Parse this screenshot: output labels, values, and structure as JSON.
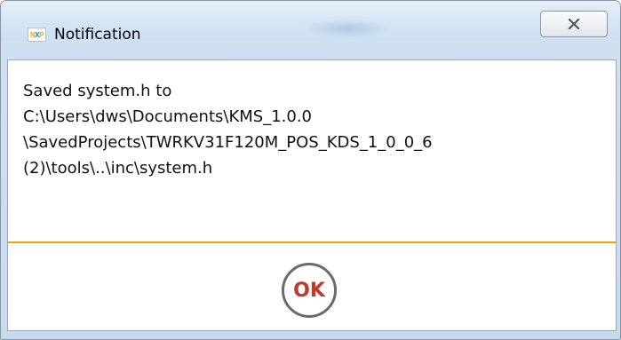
{
  "window": {
    "title": "Notification",
    "icon": "nxp-logo-icon",
    "close_icon": "close-icon"
  },
  "message": {
    "lines": [
      "Saved system.h to",
      "C:\\Users\\dws\\Documents\\KMS_1.0.0",
      "\\SavedProjects\\TWRKV31F120M_POS_KDS_1_0_0_6",
      "(2)\\tools\\..\\inc\\system.h"
    ]
  },
  "buttons": {
    "ok_label": "OK"
  },
  "colors": {
    "separator": "#f0a400",
    "ok_text": "#c0392b",
    "logo_n": "#f39c12",
    "logo_x": "#1a7fd1",
    "logo_p": "#8dc63f"
  }
}
